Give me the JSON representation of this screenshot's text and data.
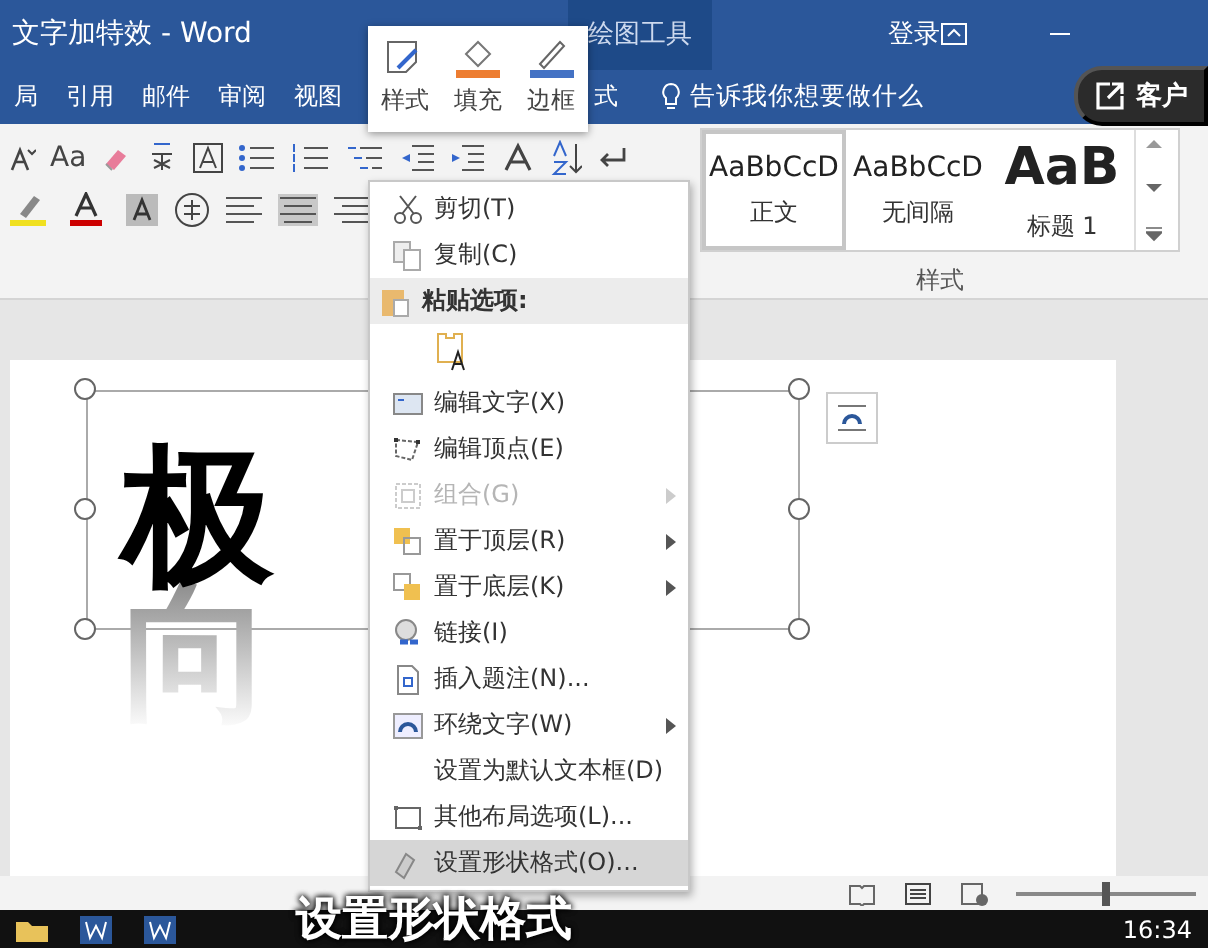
{
  "window": {
    "title": "文字加特效 - Word",
    "context_tab": "绘图工具",
    "sign_in": "登录"
  },
  "ribbon_tabs": [
    {
      "label": "局"
    },
    {
      "label": "引用"
    },
    {
      "label": "邮件"
    },
    {
      "label": "审阅"
    },
    {
      "label": "视图"
    },
    {
      "label": "式"
    }
  ],
  "tell_me": "告诉我你想要做什么",
  "share_button": "客户",
  "mini_toolbar": [
    {
      "label": "样式",
      "kind": "style"
    },
    {
      "label": "填充",
      "kind": "fill"
    },
    {
      "label": "边框",
      "kind": "border"
    }
  ],
  "ribbon_buttons": [
    {
      "label": "Aa"
    }
  ],
  "styles": {
    "group_label": "样式",
    "items": [
      {
        "preview": "AaBbCcD",
        "label": "正文",
        "selected": true,
        "kind": "normal"
      },
      {
        "preview": "AaBbCcD",
        "label": "无间隔",
        "selected": false,
        "kind": "normal"
      },
      {
        "preview": "AaB",
        "label": "标题 1",
        "selected": false,
        "kind": "heading"
      }
    ]
  },
  "document": {
    "lines": [
      {
        "text": "极",
        "kind": "solid"
      },
      {
        "text": "向",
        "kind": "faded"
      }
    ]
  },
  "zoom": {
    "level": 0.5
  },
  "context_menu": [
    {
      "kind": "command",
      "label": "剪切(T)",
      "disabled": false,
      "submenu": false,
      "selected": false
    },
    {
      "kind": "command",
      "label": "复制(C)",
      "disabled": false,
      "submenu": false,
      "selected": false
    },
    {
      "kind": "header",
      "label": "粘贴选项:"
    },
    {
      "kind": "paste"
    },
    {
      "kind": "command",
      "label": "编辑文字(X)",
      "disabled": false,
      "submenu": false,
      "selected": false
    },
    {
      "kind": "command",
      "label": "编辑顶点(E)",
      "disabled": false,
      "submenu": false,
      "selected": false
    },
    {
      "kind": "command",
      "label": "组合(G)",
      "disabled": true,
      "submenu": true,
      "selected": false
    },
    {
      "kind": "command",
      "label": "置于顶层(R)",
      "disabled": false,
      "submenu": true,
      "selected": false
    },
    {
      "kind": "command",
      "label": "置于底层(K)",
      "disabled": false,
      "submenu": true,
      "selected": false
    },
    {
      "kind": "command",
      "label": "链接(I)",
      "disabled": false,
      "submenu": false,
      "selected": false
    },
    {
      "kind": "command",
      "label": "插入题注(N)...",
      "disabled": false,
      "submenu": false,
      "selected": false
    },
    {
      "kind": "command",
      "label": "环绕文字(W)",
      "disabled": false,
      "submenu": true,
      "selected": false
    },
    {
      "kind": "command",
      "label": "设置为默认文本框(D)",
      "disabled": false,
      "submenu": false,
      "selected": false
    },
    {
      "kind": "command",
      "label": "其他布局选项(L)...",
      "disabled": false,
      "submenu": false,
      "selected": false
    },
    {
      "kind": "command",
      "label": "设置形状格式(O)...",
      "disabled": false,
      "submenu": false,
      "selected": true
    }
  ],
  "taskbar": {
    "time": "16:34"
  },
  "subtitle": "设置形状格式"
}
